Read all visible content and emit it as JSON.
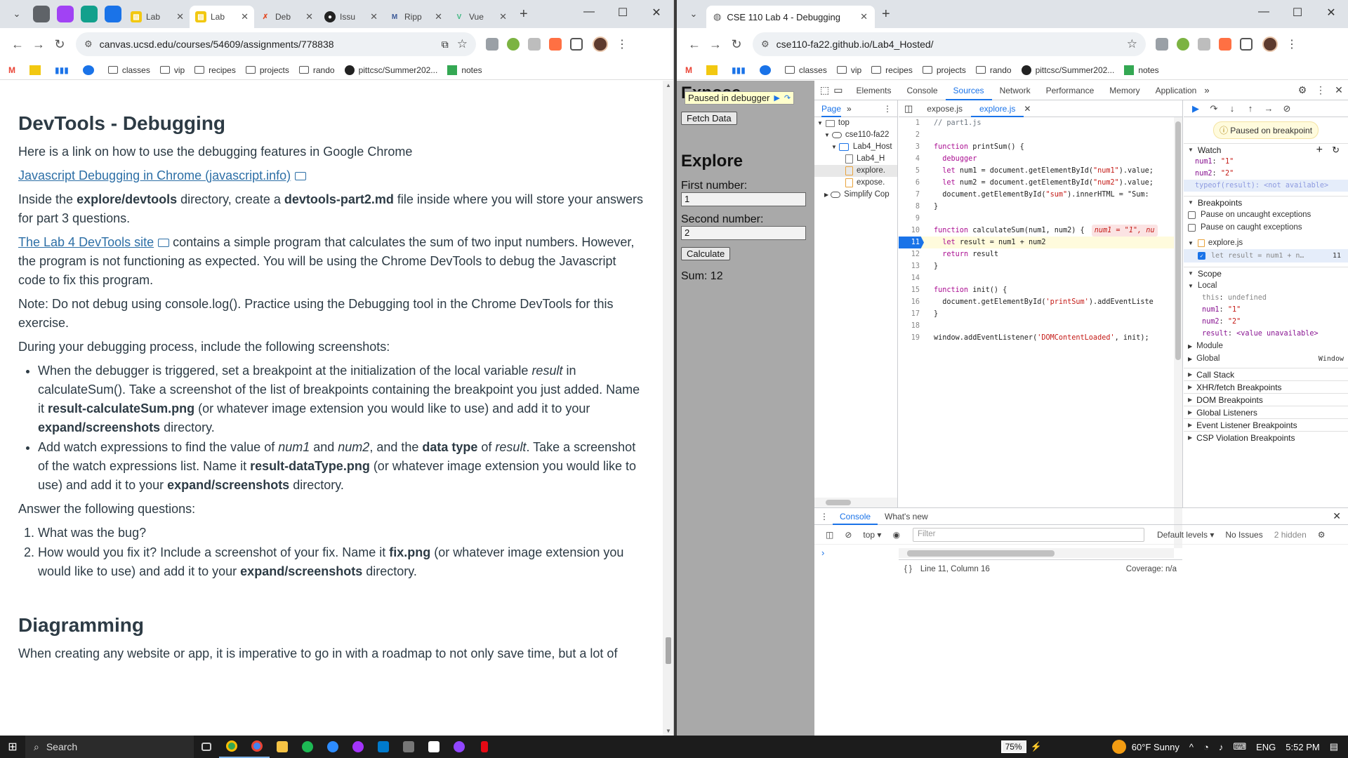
{
  "left_browser": {
    "tabs": [
      {
        "title": "Lab",
        "color": "#f2c811"
      },
      {
        "title": "Lab",
        "color": "#f2c811",
        "active": true
      },
      {
        "title": "Deb",
        "color": "#e34c26"
      },
      {
        "title": "Issu",
        "color": "#222222"
      },
      {
        "title": "Ripp",
        "color": "#3b5998"
      },
      {
        "title": "Vue",
        "color": "#41b883"
      }
    ],
    "url": "canvas.ucsd.edu/courses/54609/assignments/778838",
    "bookmarks": [
      "classes",
      "vip",
      "recipes",
      "projects",
      "rando",
      "pittcsc/Summer202...",
      "notes"
    ]
  },
  "doc": {
    "title": "DevTools - Debugging",
    "intro": "Here is a link on how to use the debugging features in Google Chrome",
    "link1": "Javascript Debugging in Chrome (javascript.info)",
    "p2_a": "Inside the ",
    "p2_b": "explore/devtools",
    "p2_c": " directory, create a ",
    "p2_d": "devtools-part2.md",
    "p2_e": " file inside where you will store your answers for part 3 questions.",
    "link2": "The Lab 4 DevTools site",
    "p3": " contains a simple program that calculates the sum of two input numbers. However, the program is not functioning as expected. You will be using the Chrome DevTools to debug the Javascript code to fix this program.",
    "note": "Note: Do not debug using console.log(). Practice using the Debugging tool in the Chrome DevTools for this exercise.",
    "during": "During your debugging process, include the following screenshots:",
    "b1_a": "When the debugger is triggered, set a breakpoint at the initialization of the local variable ",
    "b1_b": "result",
    "b1_c": " in calculateSum(). Take a screenshot of the list of breakpoints containing the breakpoint you just added. Name it ",
    "b1_d": "result-calculateSum.png",
    "b1_e": " (or whatever image extension you would like to use) and add it to your ",
    "b1_f": "expand/screenshots",
    "b1_g": " directory.",
    "b2_a": "Add watch expressions to find the value of ",
    "b2_b": "num1",
    "b2_c": " and ",
    "b2_d": "num2",
    "b2_e": ", and the ",
    "b2_f": "data type",
    "b2_g": " of ",
    "b2_h": "result",
    "b2_i": ". Take a screenshot of the watch expressions list. Name it ",
    "b2_j": "result-dataType.png",
    "b2_k": " (or whatever image extension you would like to use) and add it to your ",
    "b2_l": "expand/screenshots",
    "b2_m": " directory.",
    "answer": "Answer the following questions:",
    "q1": "What was the bug?",
    "q2_a": "How would you fix it? Include a screenshot of your fix. Name it ",
    "q2_b": "fix.png",
    "q2_c": " (or whatever image extension you would like to use) and add it to your ",
    "q2_d": "expand/screenshots",
    "q2_e": " directory.",
    "h2": "Diagramming",
    "last": "When creating any website or app, it is imperative to go in with a roadmap to not only save time, but a lot of"
  },
  "right_browser": {
    "tab_title": "CSE 110 Lab 4 - Debugging",
    "url": "cse110-fa22.github.io/Lab4_Hosted/",
    "bookmarks": [
      "classes",
      "vip",
      "recipes",
      "projects",
      "rando",
      "pittcsc/Summer202...",
      "notes"
    ]
  },
  "page": {
    "paused_label": "Paused in debugger",
    "h_expose": "Expose",
    "fetch_btn": "Fetch Data",
    "h_explore": "Explore",
    "first_label": "First number:",
    "first_value": "1",
    "second_label": "Second number:",
    "second_value": "2",
    "calc_btn": "Calculate",
    "sum": "Sum: 12"
  },
  "devtools": {
    "tabs": [
      "Elements",
      "Console",
      "Sources",
      "Network",
      "Performance",
      "Memory",
      "Application"
    ],
    "nav_tab": "Page",
    "tree": [
      "top",
      "cse110-fa22",
      "Lab4_Host",
      "Lab4_H",
      "explore.",
      "expose.",
      "Simplify Cop"
    ],
    "editor_tabs": [
      "expose.js",
      "explore.js"
    ],
    "code": [
      {
        "n": "1",
        "t": "// part1.js"
      },
      {
        "n": "2",
        "t": ""
      },
      {
        "n": "3",
        "t": "function printSum() {"
      },
      {
        "n": "4",
        "t": "  debugger"
      },
      {
        "n": "5",
        "t": "  let num1 = document.getElementById(\"num1\").value;"
      },
      {
        "n": "6",
        "t": "  let num2 = document.getElementById(\"num2\").value;"
      },
      {
        "n": "7",
        "t": "  document.getElementById(\"sum\").innerHTML = \"Sum: "
      },
      {
        "n": "8",
        "t": "}"
      },
      {
        "n": "9",
        "t": ""
      },
      {
        "n": "10",
        "t": "function calculateSum(num1, num2) {"
      },
      {
        "n": "11",
        "t": "  let result = num1 + num2"
      },
      {
        "n": "12",
        "t": "  return result"
      },
      {
        "n": "13",
        "t": "}"
      },
      {
        "n": "14",
        "t": ""
      },
      {
        "n": "15",
        "t": "function init() {"
      },
      {
        "n": "16",
        "t": "  document.getElementById('printSum').addEventListe"
      },
      {
        "n": "17",
        "t": "}"
      },
      {
        "n": "18",
        "t": ""
      },
      {
        "n": "19",
        "t": "window.addEventListener('DOMContentLoaded', init);"
      }
    ],
    "inline_value": "num1 = \"1\", nu",
    "status_pos": "Line 11, Column 16",
    "status_cov": "Coverage: n/a",
    "paused_on": "Paused on breakpoint",
    "watch_label": "Watch",
    "watch": [
      {
        "k": "num1",
        "v": "\"1\""
      },
      {
        "k": "num2",
        "v": "\"2\""
      },
      {
        "k": "typeof(result)",
        "v": "<not available>"
      }
    ],
    "breakpoints_label": "Breakpoints",
    "pause_uncaught": "Pause on uncaught exceptions",
    "pause_caught": "Pause on caught exceptions",
    "bp_file": "explore.js",
    "bp_line": "let result = num1 + n…",
    "bp_num": "11",
    "scope_label": "Scope",
    "local_label": "Local",
    "scope": [
      {
        "k": "this",
        "v": "undefined"
      },
      {
        "k": "num1",
        "v": "\"1\""
      },
      {
        "k": "num2",
        "v": "\"2\""
      },
      {
        "k": "result",
        "v": "<value unavailable>"
      }
    ],
    "module_label": "Module",
    "global_label": "Global",
    "global_value": "Window",
    "more_sections": [
      "Call Stack",
      "XHR/fetch Breakpoints",
      "DOM Breakpoints",
      "Global Listeners",
      "Event Listener Breakpoints",
      "CSP Violation Breakpoints"
    ],
    "drawer_tabs": [
      "Console",
      "What's new"
    ],
    "context": "top",
    "filter_placeholder": "Filter",
    "levels": "Default levels",
    "issues": "No Issues",
    "hidden": "2 hidden"
  },
  "taskbar": {
    "search": "Search",
    "battery": "75%",
    "weather": "60°F  Sunny",
    "lang": "ENG",
    "time": "5:52 PM"
  }
}
